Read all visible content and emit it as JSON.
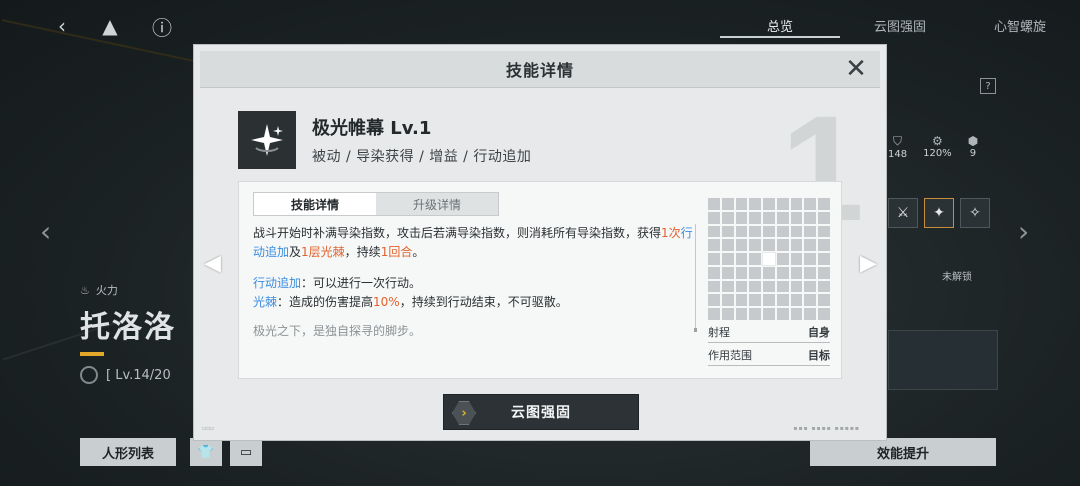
{
  "background": {
    "tabs": [
      "总览",
      "云图强固",
      "心智螺旋"
    ],
    "character": {
      "element": "火力",
      "name": "托洛洛",
      "level": "[ Lv.14/20"
    },
    "stats": [
      "148",
      "120%",
      "9"
    ],
    "unlock_label": "未解锁",
    "bottom_buttons": {
      "doll_list": "人形列表",
      "upgrade": "效能提升"
    }
  },
  "dialog": {
    "title": "技能详情",
    "big_number": "1",
    "skill": {
      "icon": "sparkle-star-icon",
      "name": "极光帷幕 Lv.1",
      "tags": "被动 / 导染获得 / 增益 / 行动追加"
    },
    "tabs": {
      "details": "技能详情",
      "upgrade": "升级详情"
    },
    "description": {
      "p1_a": "战斗开始时补满导染指数，攻击后若满导染指数，则消耗所有导染指数，获得",
      "p1_b": "1次",
      "p1_c": "行动追加",
      "p1_d": "及",
      "p1_e": "1层光棘",
      "p1_f": "，持续",
      "p1_g": "1回合",
      "p1_h": "。",
      "p2_term": "行动追加",
      "p2_text": "：可以进行一次行动。",
      "p3_term": "光棘",
      "p3_text_a": "：造成的伤害提高",
      "p3_value": "10%",
      "p3_text_b": "，持续到行动结束，不可驱散。",
      "flavor": "极光之下，是独自探寻的脚步。"
    },
    "range": {
      "range_label": "射程",
      "range_value": "自身",
      "area_label": "作用范围",
      "area_value": "目标"
    },
    "enhance_button": "云图强固"
  },
  "colors": {
    "accent_orange": "#e2622b",
    "accent_blue": "#3a8de0",
    "accent_gold": "#e3b12f"
  }
}
